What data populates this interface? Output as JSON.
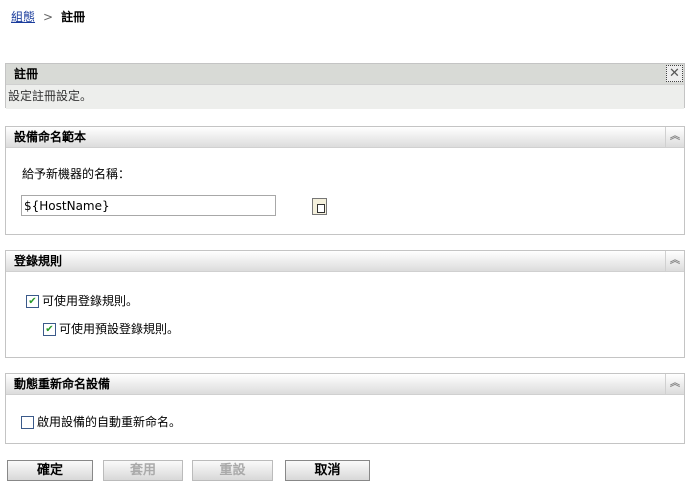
{
  "breadcrumb": {
    "parent": "組態",
    "separator": ">",
    "current": "註冊"
  },
  "intro_panel": {
    "title": "註冊",
    "description": "設定註冊設定。",
    "close_icon": "close-icon"
  },
  "naming_panel": {
    "title": "設備命名範本",
    "label": "給予新機器的名稱：",
    "value": "${HostName}",
    "insert_icon": "insert-variable-icon"
  },
  "rules_panel": {
    "title": "登錄規則",
    "enable_rules": {
      "label": "可使用登錄規則。",
      "checked": true
    },
    "enable_default_rules": {
      "label": "可使用預設登錄規則。",
      "checked": true
    }
  },
  "rename_panel": {
    "title": "動態重新命名設備",
    "enable_rename": {
      "label": "啟用設備的自動重新命名。",
      "checked": false
    }
  },
  "buttons": {
    "ok": "確定",
    "apply": "套用",
    "reset": "重設",
    "cancel": "取消"
  },
  "collapse_glyph": "︽",
  "check_glyph": "✔",
  "close_glyph": "✕"
}
